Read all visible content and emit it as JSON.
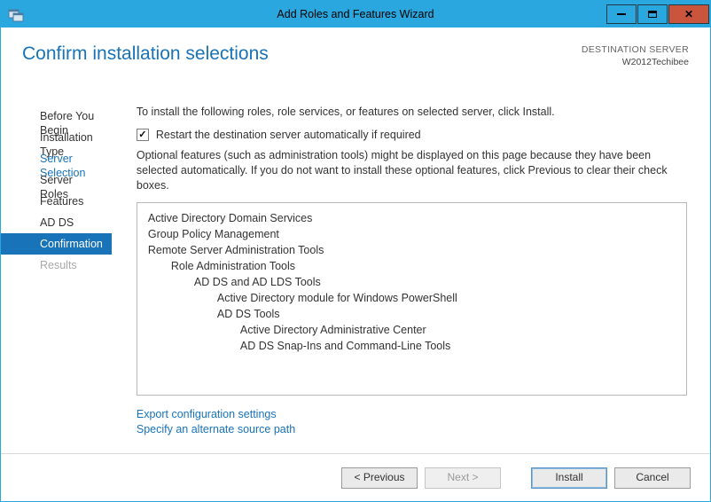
{
  "window": {
    "title": "Add Roles and Features Wizard"
  },
  "header": {
    "page_title": "Confirm installation selections",
    "destination_label": "DESTINATION SERVER",
    "destination_host": "W2012Techibee"
  },
  "sidebar": {
    "steps": [
      {
        "label": "Before You Begin",
        "state": "normal"
      },
      {
        "label": "Installation Type",
        "state": "normal"
      },
      {
        "label": "Server Selection",
        "state": "link"
      },
      {
        "label": "Server Roles",
        "state": "normal"
      },
      {
        "label": "Features",
        "state": "normal"
      },
      {
        "label": "AD DS",
        "state": "normal"
      },
      {
        "label": "Confirmation",
        "state": "active"
      },
      {
        "label": "Results",
        "state": "disabled"
      }
    ]
  },
  "main": {
    "instruction": "To install the following roles, role services, or features on selected server, click Install.",
    "restart_checked": true,
    "restart_label": "Restart the destination server automatically if required",
    "optional_text": "Optional features (such as administration tools) might be displayed on this page because they have been selected automatically. If you do not want to install these optional features, click Previous to clear their check boxes.",
    "features": [
      {
        "level": 0,
        "label": "Active Directory Domain Services"
      },
      {
        "level": 0,
        "label": "Group Policy Management"
      },
      {
        "level": 0,
        "label": "Remote Server Administration Tools"
      },
      {
        "level": 1,
        "label": "Role Administration Tools"
      },
      {
        "level": 2,
        "label": "AD DS and AD LDS Tools"
      },
      {
        "level": 3,
        "label": "Active Directory module for Windows PowerShell"
      },
      {
        "level": 3,
        "label": "AD DS Tools"
      },
      {
        "level": 4,
        "label": "Active Directory Administrative Center"
      },
      {
        "level": 4,
        "label": "AD DS Snap-Ins and Command-Line Tools"
      }
    ],
    "links": {
      "export": "Export configuration settings",
      "alt_source": "Specify an alternate source path"
    }
  },
  "footer": {
    "previous": "< Previous",
    "next": "Next >",
    "install": "Install",
    "cancel": "Cancel"
  }
}
